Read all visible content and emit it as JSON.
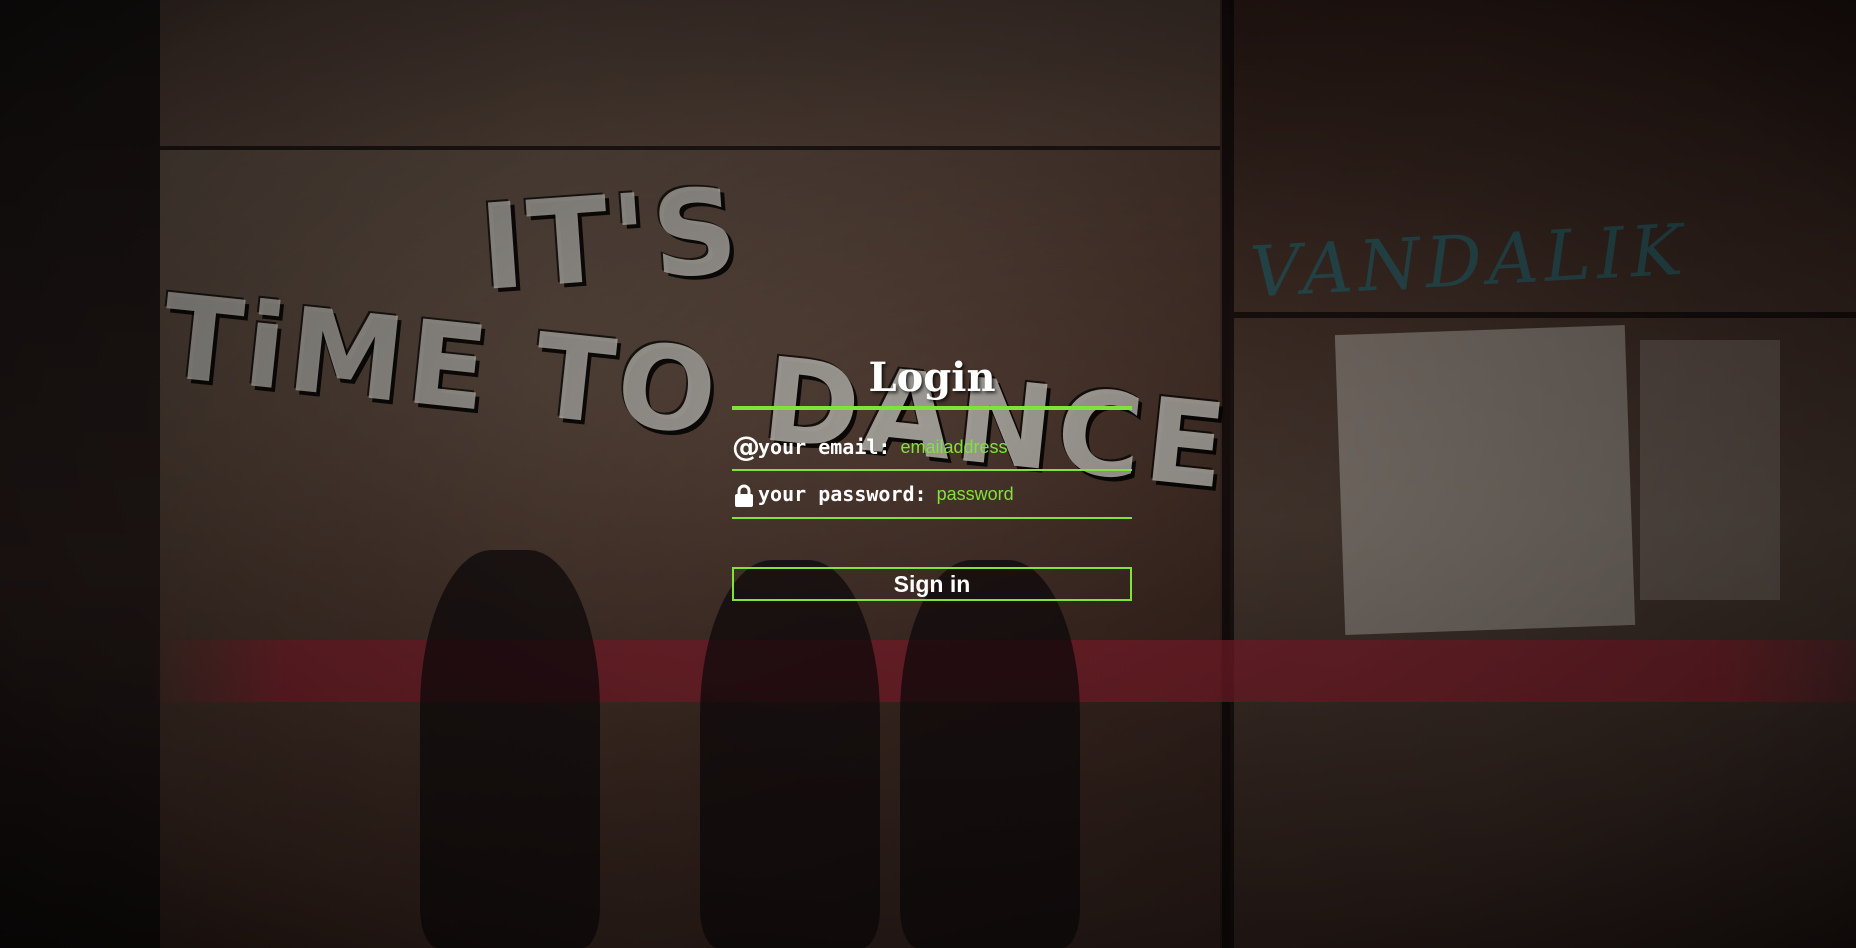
{
  "login": {
    "title": "Login",
    "email": {
      "label": "your email:",
      "placeholder": "emailaddress",
      "value": "",
      "icon": "at-sign-icon"
    },
    "password": {
      "label": "your password:",
      "placeholder": "password",
      "value": "",
      "icon": "lock-icon"
    },
    "submit_label": "Sign in"
  },
  "theme": {
    "accent": "#7fe33a",
    "text": "#ffffff"
  }
}
